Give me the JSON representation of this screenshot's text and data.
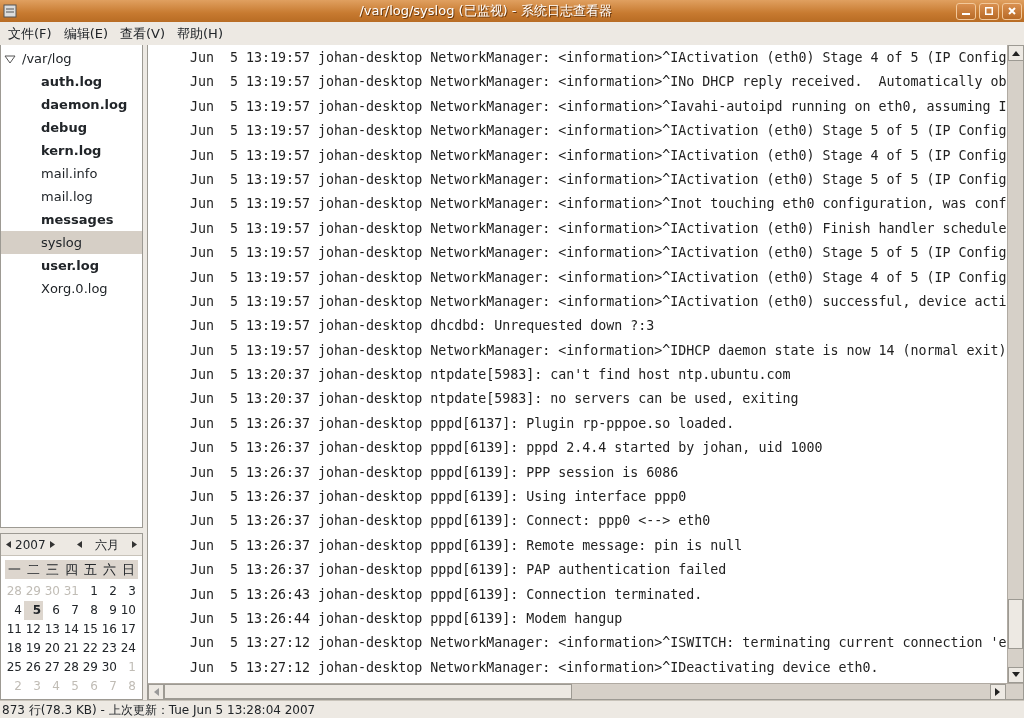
{
  "window": {
    "title": "/var/log/syslog (已监视) - 系统日志查看器"
  },
  "menu": [
    "文件(F)",
    "编辑(E)",
    "查看(V)",
    "帮助(H)"
  ],
  "sidebar": {
    "folder": {
      "label": "/var/log",
      "expanded": true,
      "children": [
        {
          "label": "auth.log",
          "updated": true,
          "selected": false
        },
        {
          "label": "daemon.log",
          "updated": true,
          "selected": false
        },
        {
          "label": "debug",
          "updated": true,
          "selected": false
        },
        {
          "label": "kern.log",
          "updated": true,
          "selected": false
        },
        {
          "label": "mail.info",
          "updated": false,
          "selected": false
        },
        {
          "label": "mail.log",
          "updated": false,
          "selected": false
        },
        {
          "label": "messages",
          "updated": true,
          "selected": false
        },
        {
          "label": "syslog",
          "updated": false,
          "selected": true
        },
        {
          "label": "user.log",
          "updated": true,
          "selected": false
        },
        {
          "label": "Xorg.0.log",
          "updated": false,
          "selected": false
        }
      ]
    }
  },
  "calendar": {
    "year": "2007",
    "month": "六月",
    "weekdays": [
      "一",
      "二",
      "三",
      "四",
      "五",
      "六",
      "日"
    ],
    "weeks": [
      [
        {
          "day": "28",
          "other_month": true,
          "selected": false
        },
        {
          "day": "29",
          "other_month": true,
          "selected": false
        },
        {
          "day": "30",
          "other_month": true,
          "selected": false
        },
        {
          "day": "31",
          "other_month": true,
          "selected": false
        },
        {
          "day": "1",
          "other_month": false,
          "selected": false
        },
        {
          "day": "2",
          "other_month": false,
          "selected": false
        },
        {
          "day": "3",
          "other_month": false,
          "selected": false
        }
      ],
      [
        {
          "day": "4",
          "other_month": false,
          "selected": false
        },
        {
          "day": "5",
          "other_month": false,
          "selected": true
        },
        {
          "day": "6",
          "other_month": false,
          "selected": false
        },
        {
          "day": "7",
          "other_month": false,
          "selected": false
        },
        {
          "day": "8",
          "other_month": false,
          "selected": false
        },
        {
          "day": "9",
          "other_month": false,
          "selected": false
        },
        {
          "day": "10",
          "other_month": false,
          "selected": false
        }
      ],
      [
        {
          "day": "11",
          "other_month": false,
          "selected": false
        },
        {
          "day": "12",
          "other_month": false,
          "selected": false
        },
        {
          "day": "13",
          "other_month": false,
          "selected": false
        },
        {
          "day": "14",
          "other_month": false,
          "selected": false
        },
        {
          "day": "15",
          "other_month": false,
          "selected": false
        },
        {
          "day": "16",
          "other_month": false,
          "selected": false
        },
        {
          "day": "17",
          "other_month": false,
          "selected": false
        }
      ],
      [
        {
          "day": "18",
          "other_month": false,
          "selected": false
        },
        {
          "day": "19",
          "other_month": false,
          "selected": false
        },
        {
          "day": "20",
          "other_month": false,
          "selected": false
        },
        {
          "day": "21",
          "other_month": false,
          "selected": false
        },
        {
          "day": "22",
          "other_month": false,
          "selected": false
        },
        {
          "day": "23",
          "other_month": false,
          "selected": false
        },
        {
          "day": "24",
          "other_month": false,
          "selected": false
        }
      ],
      [
        {
          "day": "25",
          "other_month": false,
          "selected": false
        },
        {
          "day": "26",
          "other_month": false,
          "selected": false
        },
        {
          "day": "27",
          "other_month": false,
          "selected": false
        },
        {
          "day": "28",
          "other_month": false,
          "selected": false
        },
        {
          "day": "29",
          "other_month": false,
          "selected": false
        },
        {
          "day": "30",
          "other_month": false,
          "selected": false
        },
        {
          "day": "1",
          "other_month": true,
          "selected": false
        }
      ],
      [
        {
          "day": "2",
          "other_month": true,
          "selected": false
        },
        {
          "day": "3",
          "other_month": true,
          "selected": false
        },
        {
          "day": "4",
          "other_month": true,
          "selected": false
        },
        {
          "day": "5",
          "other_month": true,
          "selected": false
        },
        {
          "day": "6",
          "other_month": true,
          "selected": false
        },
        {
          "day": "7",
          "other_month": true,
          "selected": false
        },
        {
          "day": "8",
          "other_month": true,
          "selected": false
        }
      ]
    ]
  },
  "log_lines": [
    "Jun  5 13:19:57 johan-desktop NetworkManager: <information>^IActivation (eth0) Stage 4 of 5 (IP Config",
    "Jun  5 13:19:57 johan-desktop NetworkManager: <information>^INo DHCP reply received.  Automatically ob",
    "Jun  5 13:19:57 johan-desktop NetworkManager: <information>^Iavahi-autoipd running on eth0, assuming I",
    "Jun  5 13:19:57 johan-desktop NetworkManager: <information>^IActivation (eth0) Stage 5 of 5 (IP Config",
    "Jun  5 13:19:57 johan-desktop NetworkManager: <information>^IActivation (eth0) Stage 4 of 5 (IP Config",
    "Jun  5 13:19:57 johan-desktop NetworkManager: <information>^IActivation (eth0) Stage 5 of 5 (IP Config",
    "Jun  5 13:19:57 johan-desktop NetworkManager: <information>^Inot touching eth0 configuration, was conf",
    "Jun  5 13:19:57 johan-desktop NetworkManager: <information>^IActivation (eth0) Finish handler schedule",
    "Jun  5 13:19:57 johan-desktop NetworkManager: <information>^IActivation (eth0) Stage 5 of 5 (IP Config",
    "Jun  5 13:19:57 johan-desktop NetworkManager: <information>^IActivation (eth0) Stage 4 of 5 (IP Config",
    "Jun  5 13:19:57 johan-desktop NetworkManager: <information>^IActivation (eth0) successful, device acti",
    "Jun  5 13:19:57 johan-desktop dhcdbd: Unrequested down ?:3",
    "Jun  5 13:19:57 johan-desktop NetworkManager: <information>^IDHCP daemon state is now 14 (normal exit)",
    "Jun  5 13:20:37 johan-desktop ntpdate[5983]: can't find host ntp.ubuntu.com",
    "Jun  5 13:20:37 johan-desktop ntpdate[5983]: no servers can be used, exiting",
    "Jun  5 13:26:37 johan-desktop pppd[6137]: Plugin rp-pppoe.so loaded.",
    "Jun  5 13:26:37 johan-desktop pppd[6139]: pppd 2.4.4 started by johan, uid 1000",
    "Jun  5 13:26:37 johan-desktop pppd[6139]: PPP session is 6086",
    "Jun  5 13:26:37 johan-desktop pppd[6139]: Using interface ppp0",
    "Jun  5 13:26:37 johan-desktop pppd[6139]: Connect: ppp0 <--> eth0",
    "Jun  5 13:26:37 johan-desktop pppd[6139]: Remote message: pin is null",
    "Jun  5 13:26:37 johan-desktop pppd[6139]: PAP authentication failed",
    "Jun  5 13:26:43 johan-desktop pppd[6139]: Connection terminated.",
    "Jun  5 13:26:44 johan-desktop pppd[6139]: Modem hangup",
    "Jun  5 13:27:12 johan-desktop NetworkManager: <information>^ISWITCH: terminating current connection 'e",
    "Jun  5 13:27:12 johan-desktop NetworkManager: <information>^IDeactivating device eth0."
  ],
  "status_bar": "873 行(78.3 KB) - 上次更新：Tue Jun  5 13:28:04 2007"
}
